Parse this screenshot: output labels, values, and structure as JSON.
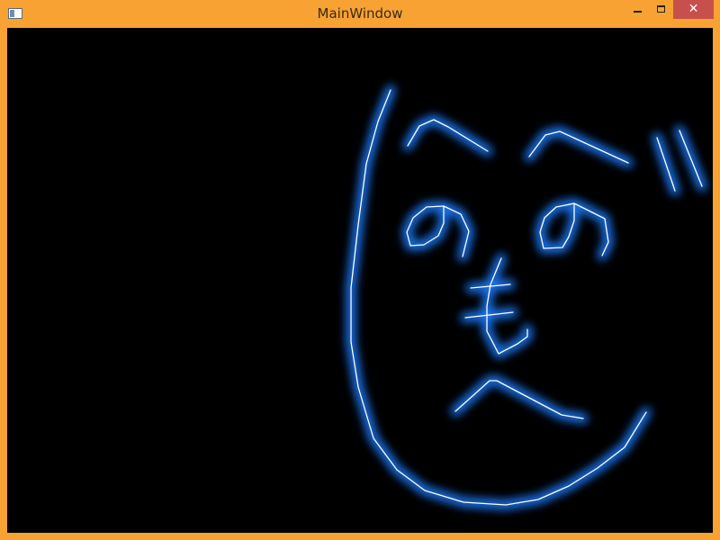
{
  "window": {
    "title": "MainWindow",
    "frame_color": "#f7a233",
    "close_color": "#c7504c"
  },
  "controls": {
    "minimize_icon": "minimize-icon",
    "maximize_icon": "maximize-icon",
    "close_icon": "close-icon",
    "close_glyph": "✕"
  },
  "canvas": {
    "background": "#000000",
    "stroke_color": "#ffffff",
    "glow_color": "#1e7bff"
  }
}
